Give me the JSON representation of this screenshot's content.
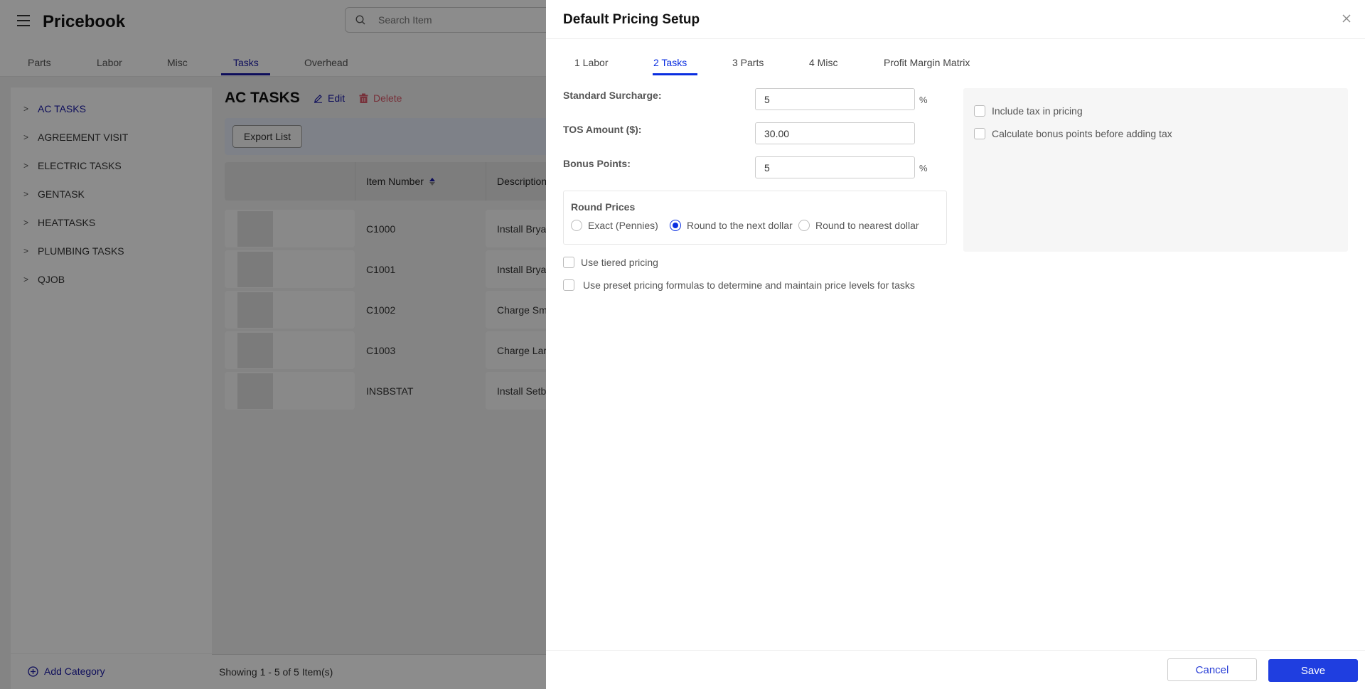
{
  "app": {
    "title": "Pricebook",
    "search_placeholder": "Search Item"
  },
  "main_tabs": [
    {
      "label": "Parts",
      "active": false
    },
    {
      "label": "Labor",
      "active": false
    },
    {
      "label": "Misc",
      "active": false
    },
    {
      "label": "Tasks",
      "active": true
    },
    {
      "label": "Overhead",
      "active": false
    }
  ],
  "sidebar": {
    "items": [
      {
        "label": "AC TASKS",
        "active": true
      },
      {
        "label": "AGREEMENT VISIT",
        "active": false
      },
      {
        "label": "ELECTRIC TASKS",
        "active": false
      },
      {
        "label": "GENTASK",
        "active": false
      },
      {
        "label": "HEATTASKS",
        "active": false
      },
      {
        "label": "PLUMBING TASKS",
        "active": false
      },
      {
        "label": "QJOB",
        "active": false
      }
    ],
    "add_category_label": "Add Category"
  },
  "category": {
    "title": "AC TASKS",
    "edit_label": "Edit",
    "delete_label": "Delete"
  },
  "toolbar": {
    "export_label": "Export List"
  },
  "table": {
    "columns": [
      "",
      "Item Number",
      "Description"
    ],
    "rows": [
      {
        "item_number": "C1000",
        "description": "Install Brya"
      },
      {
        "item_number": "C1001",
        "description": "Install Brya"
      },
      {
        "item_number": "C1002",
        "description": "Charge Sm"
      },
      {
        "item_number": "C1003",
        "description": "Charge Lar"
      },
      {
        "item_number": "INSBSTAT",
        "description": "Install Setb"
      }
    ],
    "showing_text": "Showing 1 - 5 of 5 Item(s)"
  },
  "drawer": {
    "title": "Default Pricing Setup",
    "tabs": [
      {
        "label": "1 Labor",
        "active": false
      },
      {
        "label": "2 Tasks",
        "active": true
      },
      {
        "label": "3 Parts",
        "active": false
      },
      {
        "label": "4 Misc",
        "active": false
      },
      {
        "label": "Profit Margin Matrix",
        "active": false
      }
    ],
    "fields": {
      "standard_surcharge": {
        "label": "Standard Surcharge:",
        "value": "5",
        "unit": "%"
      },
      "tos_amount": {
        "label": "TOS Amount ($):",
        "value": "30.00"
      },
      "bonus_points": {
        "label": "Bonus Points:",
        "value": "5",
        "unit": "%"
      }
    },
    "round_prices": {
      "title": "Round Prices",
      "options": [
        {
          "label": "Exact (Pennies)",
          "checked": false
        },
        {
          "label": "Round to the next dollar",
          "checked": true
        },
        {
          "label": "Round to nearest dollar",
          "checked": false
        }
      ]
    },
    "checkboxes": [
      {
        "label": "Use tiered pricing",
        "checked": false
      },
      {
        "label": "Use preset pricing formulas to determine and maintain price levels for tasks",
        "checked": false
      }
    ],
    "tax_options": [
      {
        "label": "Include tax in pricing",
        "checked": false
      },
      {
        "label": "Calculate bonus points before adding tax",
        "checked": false
      }
    ],
    "cancel_label": "Cancel",
    "save_label": "Save"
  },
  "colors": {
    "accent": "#1a1aa6",
    "drawer_accent": "#0a2ee0",
    "save_button": "#1f3ee0",
    "delete": "#d9596a"
  }
}
